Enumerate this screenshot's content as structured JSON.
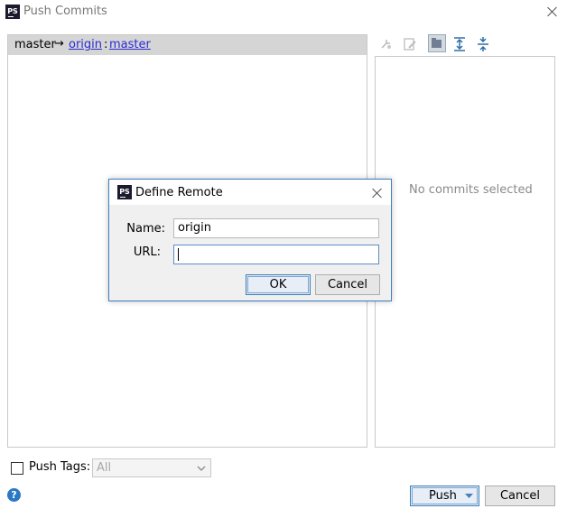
{
  "window": {
    "title": "Push Commits",
    "logo_text": "PS"
  },
  "branch": {
    "local": "master",
    "arrow": "→",
    "remote": "origin",
    "separator": ":",
    "remote_branch": "master"
  },
  "details": {
    "empty_text": "No commits selected",
    "toolbar_icons": [
      "cherry-pick-icon",
      "edit-icon",
      "folder-view-icon",
      "expand-all-icon",
      "collapse-all-icon"
    ]
  },
  "dialog": {
    "title": "Define Remote",
    "name_label": "Name:",
    "name_value": "origin",
    "url_label": "URL:",
    "url_value": "",
    "ok_label": "OK",
    "cancel_label": "Cancel"
  },
  "footer": {
    "push_tags_label": "Push Tags:",
    "tags_combo_value": "All",
    "push_label": "Push",
    "cancel_label": "Cancel"
  }
}
